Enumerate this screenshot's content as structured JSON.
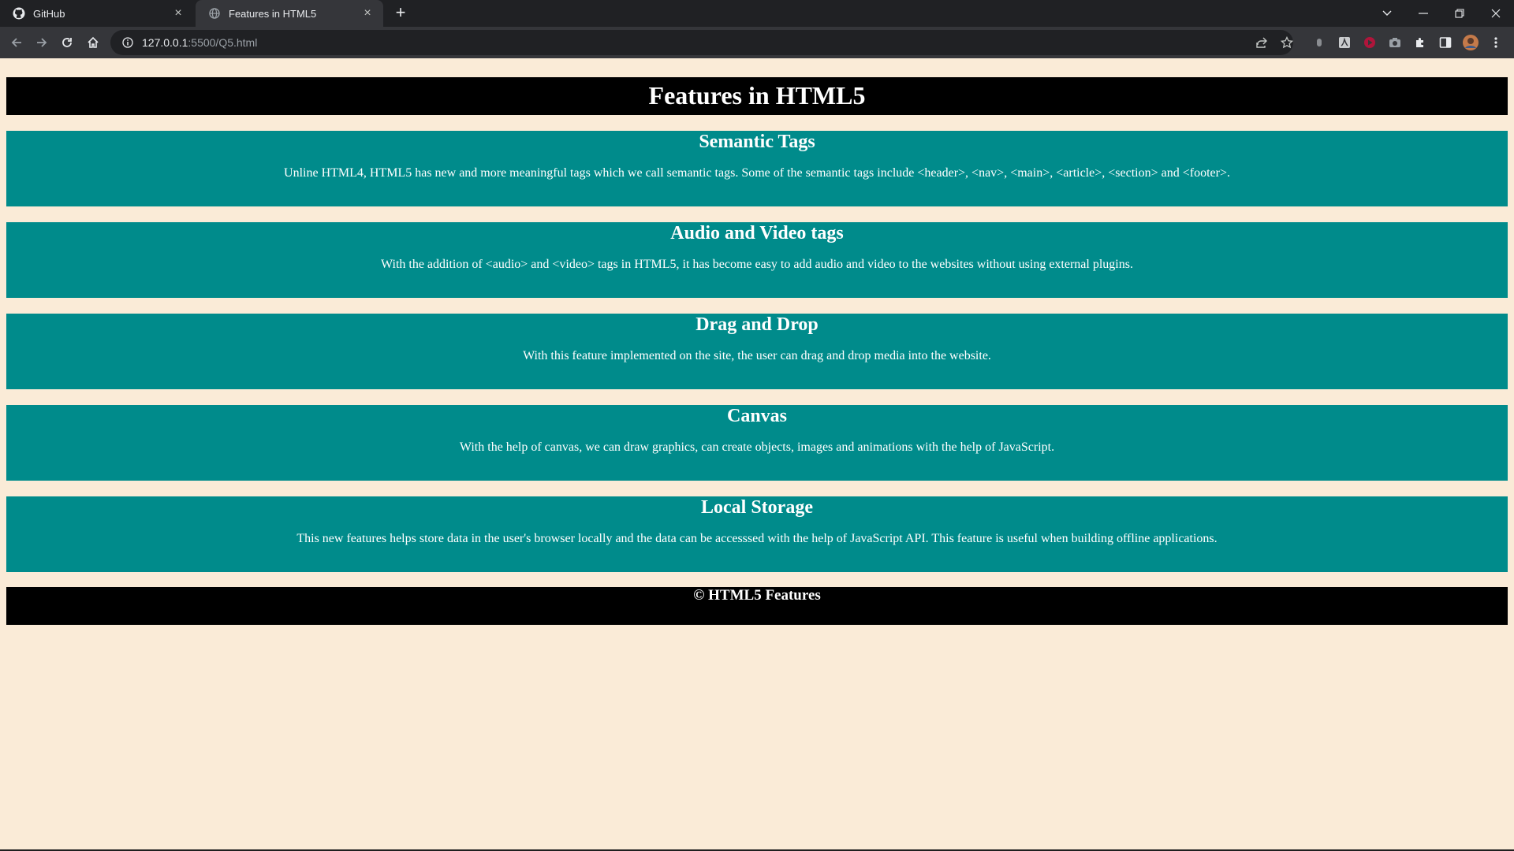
{
  "browser": {
    "tabs": [
      {
        "title": "GitHub",
        "icon": "github-icon",
        "active": false
      },
      {
        "title": "Features in HTML5",
        "icon": "globe-icon",
        "active": true
      }
    ],
    "url_host": "127.0.0.1",
    "url_path": ":5500/Q5.html"
  },
  "page": {
    "title": "Features in HTML5",
    "sections": [
      {
        "heading": "Semantic Tags",
        "text": "Unline HTML4, HTML5 has new and more meaningful tags which we call semantic tags. Some of the semantic tags include <header>, <nav>, <main>, <article>, <section> and <footer>."
      },
      {
        "heading": "Audio and Video tags",
        "text": "With the addition of <audio> and <video> tags in HTML5, it has become easy to add audio and video to the websites without using external plugins."
      },
      {
        "heading": "Drag and Drop",
        "text": "With this feature implemented on the site, the user can drag and drop media into the website."
      },
      {
        "heading": "Canvas",
        "text": "With the help of canvas, we can draw graphics, can create objects, images and animations with the help of JavaScript."
      },
      {
        "heading": "Local Storage",
        "text": "This new features helps store data in the user's browser locally and the data can be accesssed with the help of JavaScript API. This feature is useful when building offline applications."
      }
    ],
    "footer": "© HTML5 Features"
  },
  "colors": {
    "page_background": "#faebd7",
    "header_background": "#000000",
    "section_background": "#008b8b",
    "text": "#ffffff"
  }
}
